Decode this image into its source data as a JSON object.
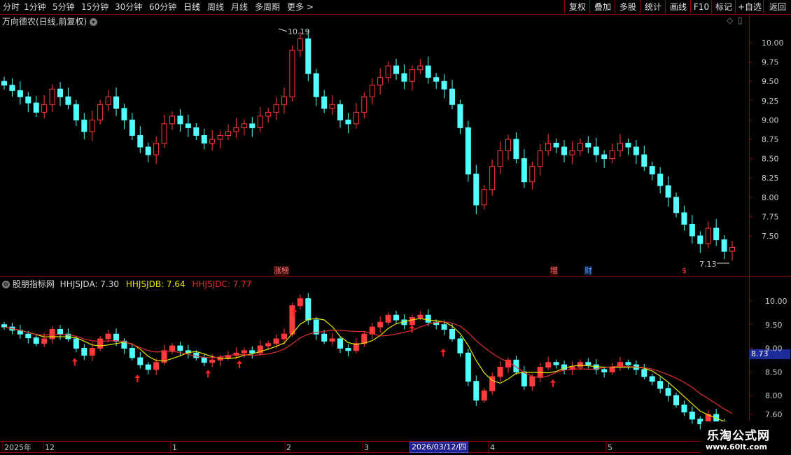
{
  "toolbar": {
    "periods": [
      "分时",
      "1分钟",
      "5分钟",
      "15分钟",
      "30分钟",
      "60分钟",
      "日线",
      "周线",
      "月线",
      "多周期",
      "更多 >"
    ],
    "active_period": "日线",
    "actions": [
      "复权",
      "叠加",
      "多股",
      "统计",
      "画线",
      "F10",
      "标记",
      "+自选",
      "返回"
    ]
  },
  "main_panel": {
    "title": "万向德农(日线,前复权)",
    "high_label": "10.19",
    "low_label": "7.13",
    "price_ticks": [
      "10.00",
      "9.75",
      "9.50",
      "9.25",
      "9.00",
      "8.75",
      "8.50",
      "8.25",
      "8.00",
      "7.75",
      "7.50"
    ],
    "event_tags": [
      {
        "text": "涨榜",
        "color": "#e05050"
      },
      {
        "text": "增",
        "color": "#e05050"
      },
      {
        "text": "财",
        "color": "#4aa0ff"
      },
      {
        "text": "$",
        "color": "#e02020"
      }
    ]
  },
  "indicator_panel": {
    "name": "股朋指标网",
    "lines": [
      {
        "label": "HHJSJDA: 7.30",
        "color": "#d8d8d8"
      },
      {
        "label": "HHJSJDB: 7.64",
        "color": "#e8e800"
      },
      {
        "label": "HHJSJDC: 7.77",
        "color": "#e03030"
      }
    ],
    "price_ticks": [
      "10.00",
      "9.50",
      "9.00",
      "8.50",
      "8.00",
      "7.60"
    ],
    "current_value": "8.73"
  },
  "date_axis": {
    "labels": [
      "2025年",
      "12",
      "1",
      "2",
      "3",
      "4",
      "5"
    ],
    "cursor_date": "2026/03/12/四"
  },
  "watermark": {
    "main": "乐淘公式网",
    "url": "www.60lt.com"
  },
  "colors": {
    "up": "#ff3c3c",
    "down": "#54ffff",
    "grid_border": "#8b0000",
    "ma_yellow": "#e8e800",
    "ma_red": "#e03030",
    "ma_white": "#d8d8d8",
    "date_highlight": "#1e1e8c"
  },
  "chart_data": {
    "type": "candlestick",
    "title": "万向德农(日线,前复权)",
    "ylim": [
      7.13,
      10.19
    ],
    "series": [
      {
        "name": "HHJSJDA",
        "values": [
          7.3
        ]
      },
      {
        "name": "HHJSJDB",
        "values": [
          7.64
        ]
      },
      {
        "name": "HHJSJDC",
        "values": [
          7.77
        ]
      }
    ],
    "close_approx": [
      9.45,
      9.38,
      9.3,
      9.22,
      9.1,
      9.2,
      9.4,
      9.3,
      9.2,
      9.0,
      8.85,
      9.0,
      9.2,
      9.3,
      9.15,
      9.0,
      8.8,
      8.65,
      8.55,
      8.7,
      8.95,
      9.05,
      8.95,
      8.9,
      8.8,
      8.7,
      8.75,
      8.8,
      8.85,
      8.9,
      8.95,
      8.9,
      9.05,
      9.1,
      9.2,
      9.3,
      9.9,
      10.05,
      9.6,
      9.3,
      9.15,
      9.2,
      9.0,
      8.95,
      9.1,
      9.3,
      9.45,
      9.55,
      9.7,
      9.6,
      9.5,
      9.65,
      9.7,
      9.55,
      9.5,
      9.4,
      9.2,
      8.9,
      8.3,
      7.9,
      8.1,
      8.4,
      8.6,
      8.75,
      8.5,
      8.2,
      8.4,
      8.6,
      8.7,
      8.65,
      8.55,
      8.6,
      8.7,
      8.65,
      8.55,
      8.5,
      8.6,
      8.7,
      8.65,
      8.55,
      8.4,
      8.3,
      8.15,
      8.0,
      7.8,
      7.65,
      7.5,
      7.4,
      7.6,
      7.45,
      7.3,
      7.35
    ]
  }
}
